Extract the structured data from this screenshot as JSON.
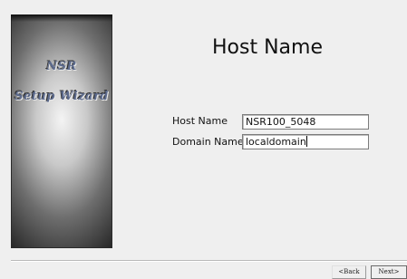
{
  "sidebar": {
    "line1": "NSR",
    "line2": "Setup Wizard"
  },
  "main": {
    "title": "Host Name",
    "fields": {
      "host_name_label": "Host Name",
      "host_name_value": "NSR100_5048",
      "domain_name_label": "Domain Name",
      "domain_name_value": "localdomain"
    }
  },
  "footer": {
    "back_label": "<Back",
    "next_label": "Next>"
  },
  "colors": {
    "sidebar_text": "#5c6a8c",
    "background": "#efefef"
  }
}
